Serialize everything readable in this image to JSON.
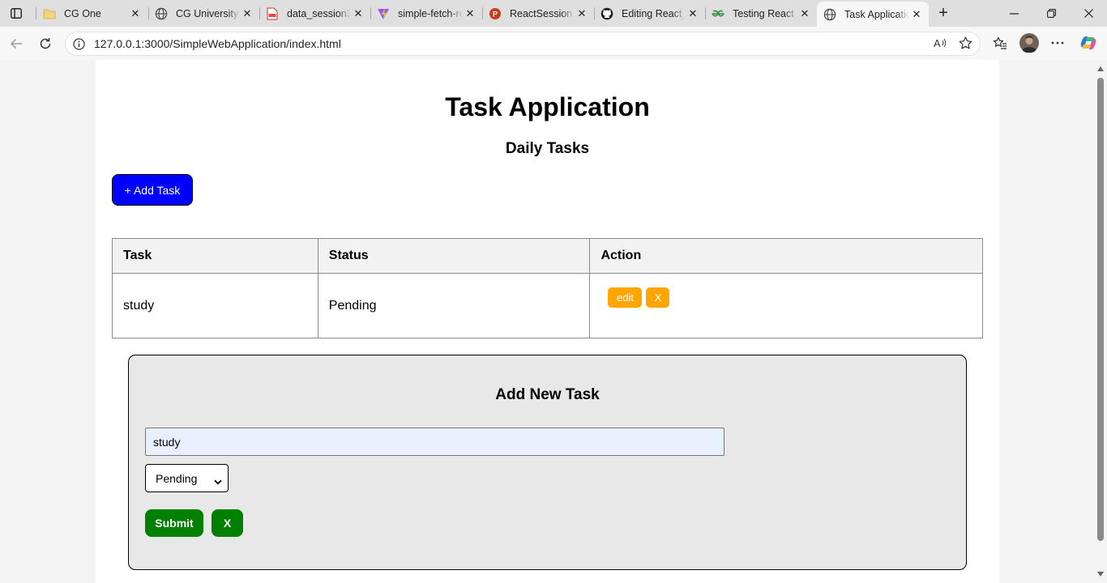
{
  "browser": {
    "tabs": [
      {
        "label": "CG One",
        "icon": "folder-icon"
      },
      {
        "label": "CG University",
        "icon": "globe-icon"
      },
      {
        "label": "data_session3_",
        "icon": "pdf-icon"
      },
      {
        "label": "simple-fetch-re",
        "icon": "vite-icon"
      },
      {
        "label": "ReactSession.p",
        "icon": "powerpoint-icon"
      },
      {
        "label": "Editing React_",
        "icon": "github-icon"
      },
      {
        "label": "Testing React A",
        "icon": "geeksforgeeks-icon"
      },
      {
        "label": "Task Applicatio",
        "icon": "globe-icon",
        "active": true
      }
    ],
    "url": "127.0.0.1:3000/SimpleWebApplication/index.html"
  },
  "app": {
    "title": "Task Application",
    "subtitle": "Daily Tasks",
    "add_button_label": "+ Add Task",
    "table": {
      "headers": [
        "Task",
        "Status",
        "Action"
      ],
      "rows": [
        {
          "task": "study",
          "status": "Pending",
          "edit_label": "edit",
          "delete_label": "X"
        }
      ]
    },
    "form": {
      "title": "Add New Task",
      "task_value": "study",
      "status_selected": "Pending",
      "submit_label": "Submit",
      "close_label": "X"
    }
  },
  "colors": {
    "add_button": "#0000ff",
    "action_buttons": "#ffa500",
    "form_buttons": "#008000",
    "input_autofill": "#e8f0fe"
  }
}
